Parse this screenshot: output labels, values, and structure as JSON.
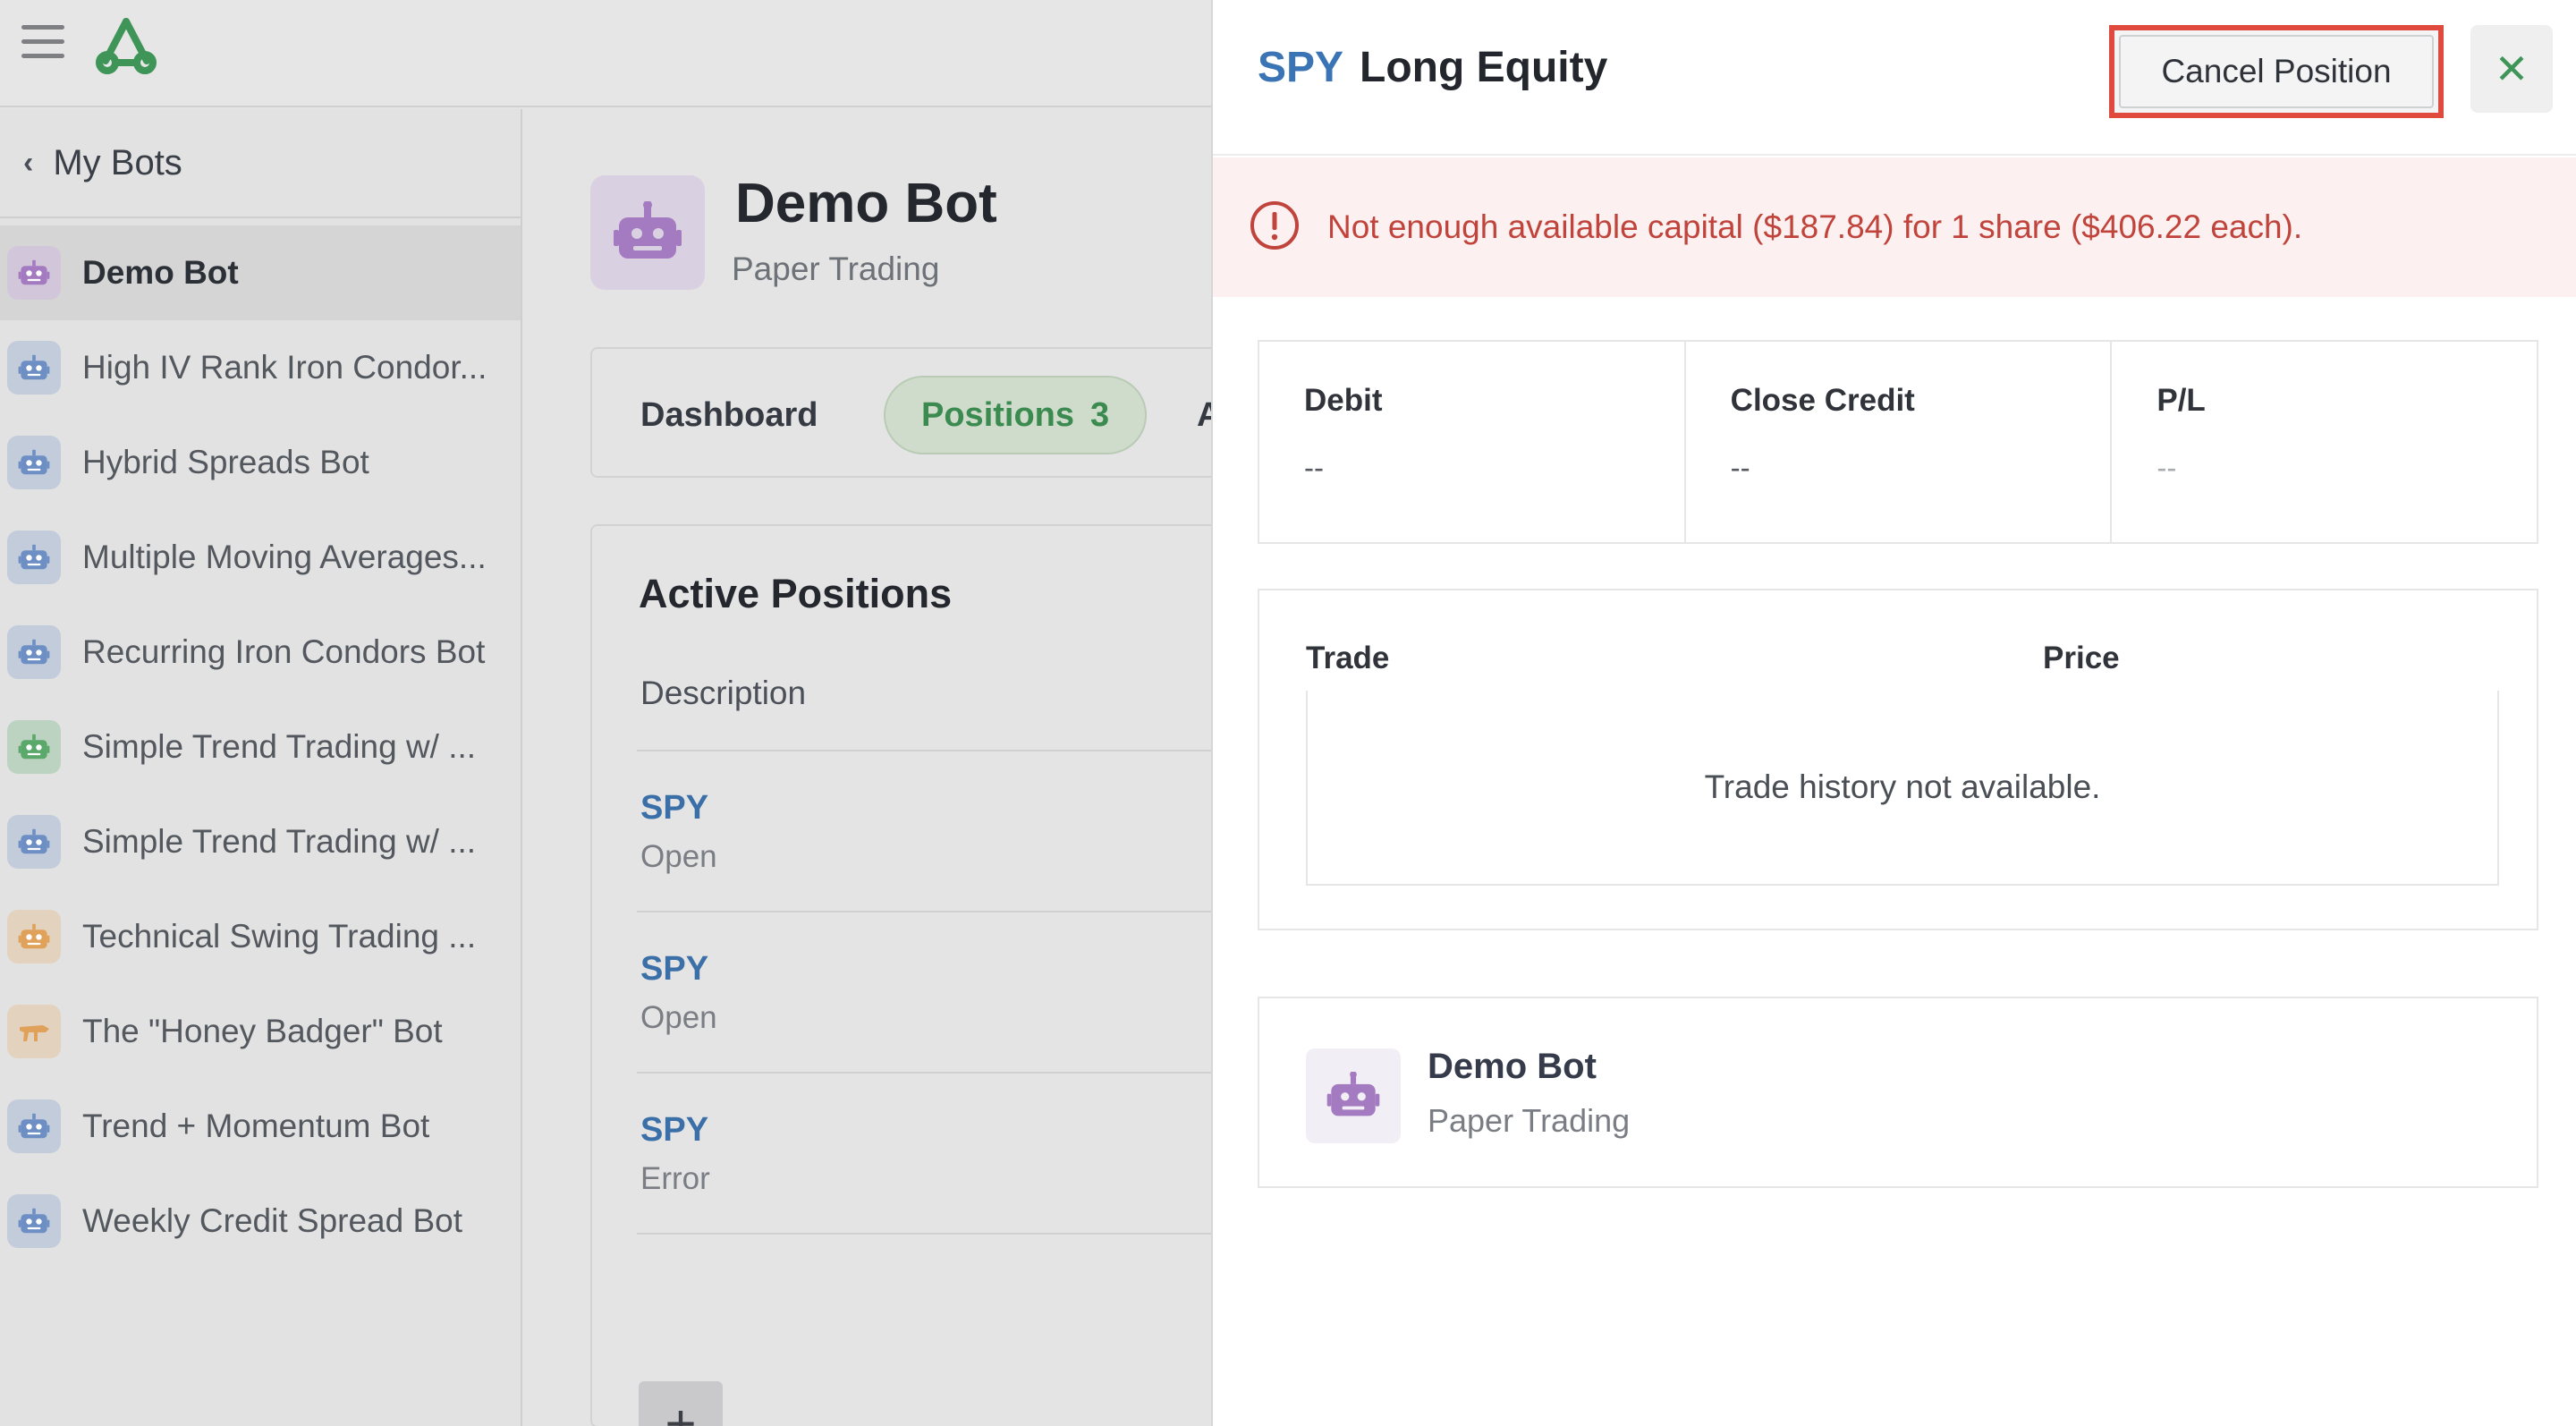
{
  "app": {
    "menu_icon": "hamburger-icon",
    "logo_icon": "triangle-logo",
    "brand_color": "#3f9457"
  },
  "sidebar": {
    "back_label": "My Bots",
    "items": [
      {
        "label": "Demo Bot",
        "icon": "robot-icon",
        "color": "#a47bc0",
        "active": true
      },
      {
        "label": "High IV Rank Iron Condor...",
        "icon": "robot-icon",
        "color": "#6e8fc4"
      },
      {
        "label": "Hybrid Spreads Bot",
        "icon": "robot-icon",
        "color": "#6e8fc4"
      },
      {
        "label": "Multiple Moving Averages...",
        "icon": "robot-icon",
        "color": "#6e8fc4"
      },
      {
        "label": "Recurring Iron Condors Bot",
        "icon": "robot-icon",
        "color": "#6e8fc4"
      },
      {
        "label": "Simple Trend Trading w/ ...",
        "icon": "robot-icon",
        "color": "#5aa86a"
      },
      {
        "label": "Simple Trend Trading w/ ...",
        "icon": "robot-icon",
        "color": "#6e8fc4"
      },
      {
        "label": "Technical Swing Trading ...",
        "icon": "robot-icon",
        "color": "#e0a25a"
      },
      {
        "label": "The \"Honey Badger\" Bot",
        "icon": "badger-icon",
        "color": "#e0a25a"
      },
      {
        "label": "Trend + Momentum Bot",
        "icon": "robot-icon",
        "color": "#6e8fc4"
      },
      {
        "label": "Weekly Credit Spread Bot",
        "icon": "robot-icon",
        "color": "#6e8fc4"
      }
    ]
  },
  "main": {
    "bot_name": "Demo Bot",
    "bot_mode": "Paper Trading",
    "tabs": {
      "dashboard": "Dashboard",
      "positions": "Positions",
      "positions_count": "3",
      "partial_next": "A"
    },
    "card_title": "Active Positions",
    "column_description": "Description",
    "positions": [
      {
        "symbol": "SPY",
        "status": "Open"
      },
      {
        "symbol": "SPY",
        "status": "Open"
      },
      {
        "symbol": "SPY",
        "status": "Error"
      }
    ],
    "add_label": "+"
  },
  "panel": {
    "symbol": "SPY",
    "title": "Long Equity",
    "cancel_label": "Cancel Position",
    "close_label": "✕",
    "alert": "Not enough available capital ($187.84) for 1 share ($406.22 each).",
    "stats": [
      {
        "label": "Debit",
        "value": "--"
      },
      {
        "label": "Close Credit",
        "value": "--"
      },
      {
        "label": "P/L",
        "value": "--"
      }
    ],
    "trades": {
      "col_trade": "Trade",
      "col_price": "Price",
      "empty": "Trade history not available."
    },
    "bot": {
      "name": "Demo Bot",
      "mode": "Paper Trading"
    }
  },
  "colors": {
    "accent_blue": "#3a74b4",
    "error_red": "#c0443c",
    "highlight_border": "#e0493d",
    "positions_green": "#3b8a4f",
    "bot_purple": "#a47bc0"
  }
}
